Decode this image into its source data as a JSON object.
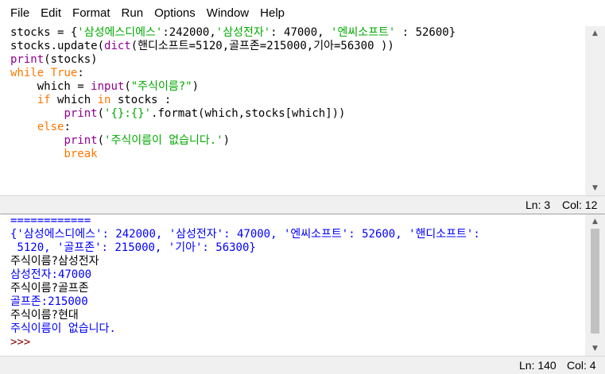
{
  "menu": [
    "File",
    "Edit",
    "Format",
    "Run",
    "Options",
    "Window",
    "Help"
  ],
  "editor": {
    "lines": [
      [
        {
          "t": "stocks = {",
          "c": "plain"
        },
        {
          "t": "'삼성에스디에스'",
          "c": "str"
        },
        {
          "t": ":242000,",
          "c": "plain"
        },
        {
          "t": "'삼성전자'",
          "c": "str"
        },
        {
          "t": ": 47000, ",
          "c": "plain"
        },
        {
          "t": "'엔씨소프트'",
          "c": "str"
        },
        {
          "t": " : 52600}",
          "c": "plain"
        }
      ],
      [
        {
          "t": "stocks.update(",
          "c": "plain"
        },
        {
          "t": "dict",
          "c": "bi"
        },
        {
          "t": "(핸디소프트=5120,골프존=215000,기아=56300 ))",
          "c": "plain"
        }
      ],
      [
        {
          "t": "print",
          "c": "bi"
        },
        {
          "t": "(stocks)",
          "c": "plain"
        }
      ],
      [
        {
          "t": "while",
          "c": "kw"
        },
        {
          "t": " ",
          "c": "plain"
        },
        {
          "t": "True",
          "c": "kw"
        },
        {
          "t": ":",
          "c": "plain"
        }
      ],
      [
        {
          "t": "    which = ",
          "c": "plain"
        },
        {
          "t": "input",
          "c": "bi"
        },
        {
          "t": "(",
          "c": "plain"
        },
        {
          "t": "\"주식이름?\"",
          "c": "str"
        },
        {
          "t": ")",
          "c": "plain"
        }
      ],
      [
        {
          "t": "    ",
          "c": "plain"
        },
        {
          "t": "if",
          "c": "kw"
        },
        {
          "t": " which ",
          "c": "plain"
        },
        {
          "t": "in",
          "c": "kw"
        },
        {
          "t": " stocks :",
          "c": "plain"
        }
      ],
      [
        {
          "t": "        ",
          "c": "plain"
        },
        {
          "t": "print",
          "c": "bi"
        },
        {
          "t": "(",
          "c": "plain"
        },
        {
          "t": "'{}:{}'",
          "c": "str"
        },
        {
          "t": ".format(which,stocks[which]))",
          "c": "plain"
        }
      ],
      [
        {
          "t": "    ",
          "c": "plain"
        },
        {
          "t": "else",
          "c": "kw"
        },
        {
          "t": ":",
          "c": "plain"
        }
      ],
      [
        {
          "t": "        ",
          "c": "plain"
        },
        {
          "t": "print",
          "c": "bi"
        },
        {
          "t": "(",
          "c": "plain"
        },
        {
          "t": "'주식이름이 없습니다.'",
          "c": "str"
        },
        {
          "t": ")",
          "c": "plain"
        }
      ],
      [
        {
          "t": "        ",
          "c": "plain"
        },
        {
          "t": "break",
          "c": "kw"
        }
      ]
    ],
    "status": {
      "ln": "Ln: 3",
      "col": "Col: 12"
    }
  },
  "shell": {
    "lines": [
      {
        "t": "============",
        "c": "out-blue"
      },
      {
        "t": "{'삼성에스디에스': 242000, '삼성전자': 47000, '엔씨소프트': 52600, '핸디소프트':",
        "c": "out-blue"
      },
      {
        "t": " 5120, '골프존': 215000, '기아': 56300}",
        "c": "out-blue"
      },
      {
        "t": "주식이름?삼성전자",
        "c": "out-black"
      },
      {
        "t": "삼성전자:47000",
        "c": "out-blue"
      },
      {
        "t": "주식이름?골프존",
        "c": "out-black"
      },
      {
        "t": "골프존:215000",
        "c": "out-blue"
      },
      {
        "t": "주식이름?현대",
        "c": "out-black"
      },
      {
        "t": "주식이름이 없습니다.",
        "c": "out-blue"
      },
      {
        "t": ">>> ",
        "c": "prompt"
      }
    ],
    "status": {
      "ln": "Ln: 140",
      "col": "Col: 4"
    }
  },
  "icons": {
    "scroll_up": "▲",
    "scroll_down": "▼"
  }
}
